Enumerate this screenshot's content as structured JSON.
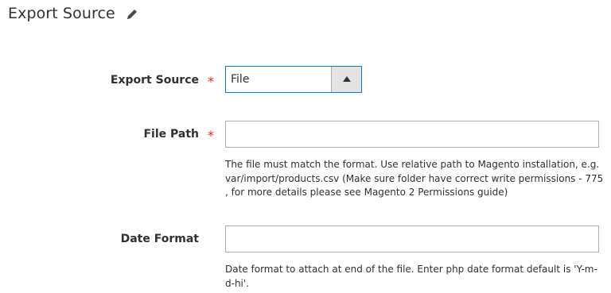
{
  "section": {
    "title": "Export Source",
    "edit_icon": "pencil-icon"
  },
  "fields": {
    "export_source": {
      "label": "Export Source",
      "required_mark": "*",
      "selected_value": "File"
    },
    "file_path": {
      "label": "File Path",
      "required_mark": "*",
      "value": "",
      "note": "The file must match the format. Use relative path to Magento installation, e.g. var/import/products.csv (Make sure folder have correct write permissions - 775 , for more details please see Magento 2 Permissions guide)"
    },
    "date_format": {
      "label": "Date Format",
      "value": "",
      "note": "Date format to attach at end of the file. Enter php date format default is 'Y-m-d-hi'."
    }
  },
  "colors": {
    "required": "#e22626",
    "focus_border": "#007bdb",
    "text": "#303030"
  }
}
